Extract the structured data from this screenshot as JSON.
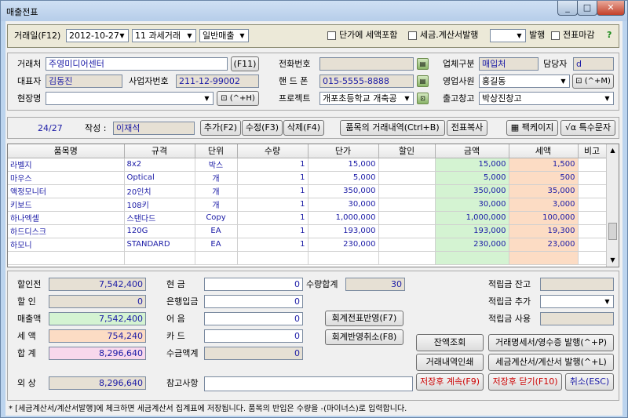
{
  "window": {
    "title": "매출전표"
  },
  "header": {
    "date_label": "거래일(F12)",
    "date": "2012-10-27",
    "tax_type": "11 과세거래",
    "sale_type": "일반매출",
    "chk_price_incl_tax": "단가에 세액포함",
    "chk_tax_invoice": "세금.계산서발행",
    "issue_label": "발행",
    "chk_close": "전표마감",
    "help": "?"
  },
  "customer": {
    "client_label": "거래처",
    "client": "주영미디어센터",
    "client_btn": "(F11)",
    "ceo_label": "대표자",
    "ceo": "김동진",
    "bizno_label": "사업자번호",
    "bizno": "211-12-99002",
    "site_label": "현장명",
    "site": "",
    "site_btn": "(^+H)",
    "phone_label": "전화번호",
    "phone": "",
    "mobile_label": "핸 드 폰",
    "mobile": "015-5555-8888",
    "project_label": "프로젝트",
    "project": "개포초등학교 개축공",
    "biztype_label": "업체구분",
    "biztype": "매입처",
    "manager_label": "담당자",
    "manager": "d",
    "sales_label": "영업사원",
    "sales": "홍길동",
    "sales_btn": "(^+M)",
    "wh_label": "출고창고",
    "wh": "박상진창고"
  },
  "toolbar": {
    "page": "24/27",
    "writer_label": "작성 :",
    "writer": "이재석",
    "add": "추가(F2)",
    "edit": "수정(F3)",
    "del": "삭제(F4)",
    "history": "품목의 거래내역(Ctrl+B)",
    "copy": "전표복사",
    "package": "팩케이지",
    "special": "특수문자"
  },
  "grid": {
    "headers": [
      "품목명",
      "규격",
      "단위",
      "수량",
      "단가",
      "할인",
      "금액",
      "세액",
      "비고"
    ],
    "rows": [
      [
        "라벨지",
        "8x2",
        "박스",
        "1",
        "15,000",
        "",
        "15,000",
        "1,500",
        ""
      ],
      [
        "마우스",
        "Optical",
        "개",
        "1",
        "5,000",
        "",
        "5,000",
        "500",
        ""
      ],
      [
        "액정모니터",
        "20인치",
        "개",
        "1",
        "350,000",
        "",
        "350,000",
        "35,000",
        ""
      ],
      [
        "키보드",
        "108키",
        "개",
        "1",
        "30,000",
        "",
        "30,000",
        "3,000",
        ""
      ],
      [
        "하나엑셀",
        "스탠다드",
        "Copy",
        "1",
        "1,000,000",
        "",
        "1,000,000",
        "100,000",
        ""
      ],
      [
        "하드디스크",
        "120G",
        "EA",
        "1",
        "193,000",
        "",
        "193,000",
        "19,300",
        ""
      ],
      [
        "하모니",
        "STANDARD",
        "EA",
        "1",
        "230,000",
        "",
        "230,000",
        "23,000",
        ""
      ]
    ]
  },
  "summary": {
    "pre_disc_label": "할인전",
    "pre_disc": "7,542,400",
    "disc_label": "할  인",
    "disc": "0",
    "sales_amt_label": "매출액",
    "sales_amt": "7,542,400",
    "tax_label": "세  액",
    "tax": "754,240",
    "total_label": "합  계",
    "total": "8,296,640",
    "credit_label": "외  상",
    "credit": "8,296,640",
    "cash_label": "현    금",
    "cash": "0",
    "bank_label": "은행입금",
    "bank": "0",
    "bill_label": "어    음",
    "bill": "0",
    "card_label": "카    드",
    "card": "0",
    "collect_label": "수금액계",
    "collect": "0",
    "qty_label": "수량합계",
    "qty": "30",
    "memo_label": "참고사항",
    "memo": "",
    "pt_bal_label": "적립금 잔고",
    "pt_add_label": "적립금 추가",
    "pt_use_label": "적립금 사용",
    "acc_apply": "회계전표반영(F7)",
    "acc_cancel": "회계반영취소(F8)",
    "balance": "잔액조회",
    "stmt_issue": "거래명세서/영수증 발행(^+P)",
    "trade_print": "거래내역인쇄",
    "tax_issue": "세금계산서/계산서 발행(^+L)",
    "save_cont": "저장후 계속(F9)",
    "save_close": "저장후 닫기(F10)",
    "cancel": "취소(ESC)"
  },
  "footer": {
    "note": "* [세금계산서/계산서발행]에 체크하면 세금계산서 집계표에 저장됩니다.  품목의 반입은 수량을 -(마이너스)로 입력합니다."
  },
  "colors": {
    "amount_bg": "#d4f3d2",
    "tax_bg": "#fcdcc4",
    "total_bg": "#f8d8ec",
    "value_text": "#1a1aa6",
    "save_text": "#cc0000"
  }
}
